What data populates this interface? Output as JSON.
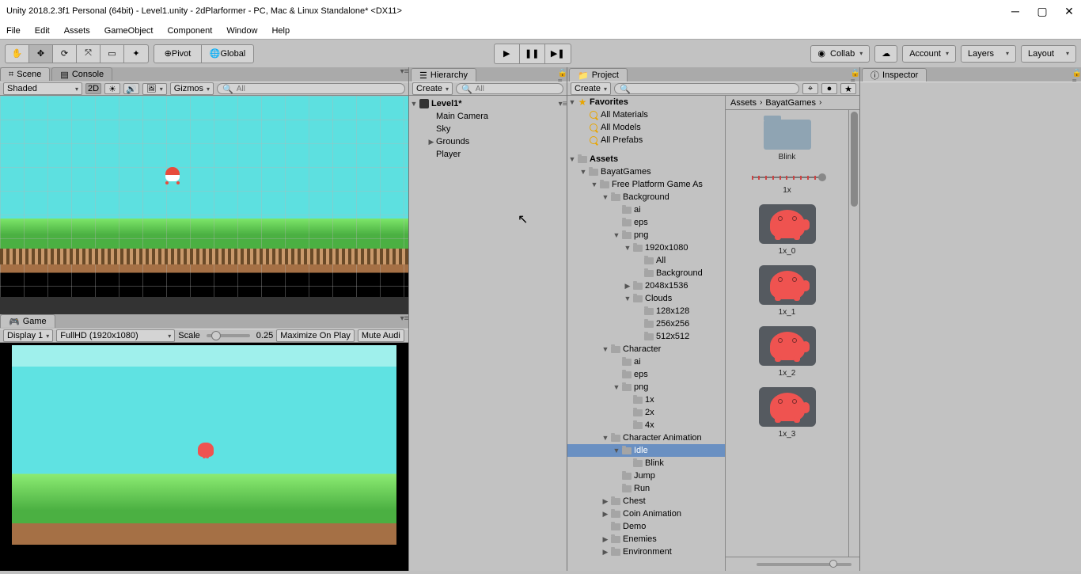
{
  "window_title": "Unity 2018.2.3f1 Personal (64bit) - Level1.unity - 2dPlarformer - PC, Mac & Linux Standalone* <DX11>",
  "menu": [
    "File",
    "Edit",
    "Assets",
    "GameObject",
    "Component",
    "Window",
    "Help"
  ],
  "toolbar": {
    "pivot": "Pivot",
    "space": "Global",
    "collab": "Collab",
    "account": "Account",
    "layers": "Layers",
    "layout": "Layout"
  },
  "scene_panel": {
    "tab_scene": "Scene",
    "tab_console": "Console",
    "shading": "Shaded",
    "mode_2d": "2D",
    "gizmos": "Gizmos",
    "search": "All"
  },
  "game_panel": {
    "tab": "Game",
    "display": "Display 1",
    "resolution": "FullHD (1920x1080)",
    "scale_label": "Scale",
    "scale_value": "0.25",
    "max": "Maximize On Play",
    "mute": "Mute Audi"
  },
  "hierarchy": {
    "title": "Hierarchy",
    "create": "Create",
    "search": "All",
    "root": "Level1*",
    "items": [
      "Main Camera",
      "Sky",
      "Grounds",
      "Player"
    ]
  },
  "project": {
    "title": "Project",
    "create": "Create",
    "favorites": {
      "header": "Favorites",
      "items": [
        "All Materials",
        "All Models",
        "All Prefabs"
      ]
    },
    "assets_header": "Assets",
    "tree": [
      {
        "d": 1,
        "fold": "open",
        "name": "BayatGames"
      },
      {
        "d": 2,
        "fold": "open",
        "name": "Free Platform Game As"
      },
      {
        "d": 3,
        "fold": "open",
        "name": "Background"
      },
      {
        "d": 4,
        "fold": "none",
        "name": "ai"
      },
      {
        "d": 4,
        "fold": "none",
        "name": "eps"
      },
      {
        "d": 4,
        "fold": "open",
        "name": "png"
      },
      {
        "d": 5,
        "fold": "open",
        "name": "1920x1080"
      },
      {
        "d": 6,
        "fold": "none",
        "name": "All"
      },
      {
        "d": 6,
        "fold": "none",
        "name": "Background"
      },
      {
        "d": 5,
        "fold": "closed",
        "name": "2048x1536"
      },
      {
        "d": 5,
        "fold": "open",
        "name": "Clouds"
      },
      {
        "d": 6,
        "fold": "none",
        "name": "128x128"
      },
      {
        "d": 6,
        "fold": "none",
        "name": "256x256"
      },
      {
        "d": 6,
        "fold": "none",
        "name": "512x512"
      },
      {
        "d": 3,
        "fold": "open",
        "name": "Character"
      },
      {
        "d": 4,
        "fold": "none",
        "name": "ai"
      },
      {
        "d": 4,
        "fold": "none",
        "name": "eps"
      },
      {
        "d": 4,
        "fold": "open",
        "name": "png"
      },
      {
        "d": 5,
        "fold": "none",
        "name": "1x"
      },
      {
        "d": 5,
        "fold": "none",
        "name": "2x"
      },
      {
        "d": 5,
        "fold": "none",
        "name": "4x"
      },
      {
        "d": 3,
        "fold": "open",
        "name": "Character Animation"
      },
      {
        "d": 4,
        "fold": "open",
        "name": "Idle",
        "sel": true
      },
      {
        "d": 5,
        "fold": "none",
        "name": "Blink"
      },
      {
        "d": 4,
        "fold": "none",
        "name": "Jump"
      },
      {
        "d": 4,
        "fold": "none",
        "name": "Run"
      },
      {
        "d": 3,
        "fold": "closed",
        "name": "Chest"
      },
      {
        "d": 3,
        "fold": "closed",
        "name": "Coin Animation"
      },
      {
        "d": 3,
        "fold": "none",
        "name": "Demo"
      },
      {
        "d": 3,
        "fold": "closed",
        "name": "Enemies"
      },
      {
        "d": 3,
        "fold": "closed",
        "name": "Environment"
      }
    ],
    "breadcrumb": [
      "Assets",
      "BayatGames"
    ],
    "grid": [
      {
        "type": "folder",
        "label": "Blink"
      },
      {
        "type": "slider",
        "label": "1x"
      },
      {
        "type": "blob",
        "label": "1x_0"
      },
      {
        "type": "blob",
        "label": "1x_1"
      },
      {
        "type": "blob",
        "label": "1x_2"
      },
      {
        "type": "blob",
        "label": "1x_3"
      }
    ]
  },
  "inspector": {
    "title": "Inspector"
  }
}
